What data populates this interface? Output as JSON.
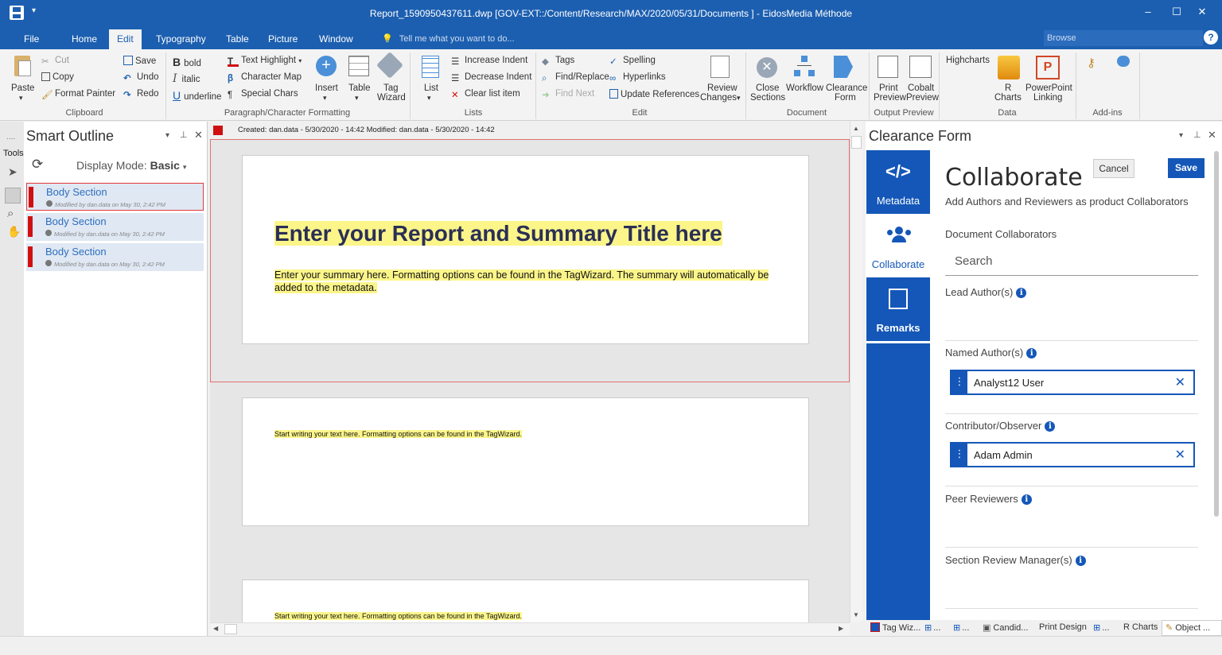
{
  "title_bar": {
    "title": "Report_1590950437611.dwp  [GOV-EXT::/Content/Research/MAX/2020/05/31/Documents ] - EidosMedia Méthode",
    "minimize": "–",
    "maximize": "☐",
    "close": "✕"
  },
  "menu": {
    "tabs": [
      "File",
      "Home",
      "Edit",
      "Typography",
      "Table",
      "Picture",
      "Window"
    ],
    "active": "Edit",
    "tell_me": "Tell me what you want to do...",
    "browse": "Browse",
    "help": "?"
  },
  "ribbon": {
    "clipboard": {
      "paste": "Paste",
      "cut": "Cut",
      "copy": "Copy",
      "format_painter": "Format Painter",
      "save": "Save",
      "undo": "Undo",
      "redo": "Redo",
      "group": "Clipboard"
    },
    "formatting": {
      "bold": "bold",
      "italic": "italic",
      "underline": "underline",
      "text_highlight": "Text Highlight",
      "character_map": "Character Map",
      "special_chars": "Special Chars",
      "insert": "Insert",
      "table": "Table",
      "tag": "Tag",
      "wizard": "Wizard",
      "group": "Paragraph/Character Formatting"
    },
    "lists": {
      "list": "List",
      "increase_indent": "Increase Indent",
      "decrease_indent": "Decrease Indent",
      "clear_list_item": "Clear list item",
      "group": "Lists"
    },
    "edit": {
      "tags": "Tags",
      "find_replace": "Find/Replace",
      "find_next": "Find Next",
      "spelling": "Spelling",
      "hyperlinks": "Hyperlinks",
      "update_references": "Update References",
      "review": "Review",
      "changes": "Changes",
      "group": "Edit"
    },
    "document": {
      "close": "Close",
      "sections": "Sections",
      "workflow": "Workflow",
      "clearance": "Clearance",
      "form": "Form",
      "group": "Document"
    },
    "output": {
      "print": "Print",
      "print_preview": "Preview",
      "cobalt": "Cobalt",
      "cobalt_preview": "Preview",
      "group": "Output Preview"
    },
    "data": {
      "highcharts": "Highcharts",
      "r": "R",
      "charts": "Charts",
      "powerpoint": "PowerPoint",
      "linking": "Linking",
      "group": "Data"
    },
    "addins": {
      "group": "Add-ins"
    }
  },
  "tools_label": "Tools",
  "smart_outline": {
    "title": "Smart Outline",
    "display_mode_label": "Display Mode:",
    "display_mode_value": "Basic",
    "sections": [
      {
        "label": "Body Section",
        "meta": "Modified by dan.data on May 30, 2:42 PM"
      },
      {
        "label": "Body Section",
        "meta": "Modified by dan.data on May 30, 2:42 PM"
      },
      {
        "label": "Body Section",
        "meta": "Modified by dan.data on May 30, 2:42 PM"
      }
    ]
  },
  "document": {
    "info": "Created: dan.data - 5/30/2020 - 14:42   Modified: dan.data - 5/30/2020 - 14:42",
    "title": "Enter your Report and Summary Title here",
    "summary": "Enter your summary here. Formatting options can be found in the TagWizard. The summary will automatically be added to the metadata.",
    "body_placeholder": "Start writing your text here. Formatting options can be found in the TagWizard."
  },
  "clearance_form": {
    "title": "Clearance Form",
    "nav": [
      "Metadata",
      "Collaborate",
      "Remarks"
    ],
    "heading": "Collaborate",
    "subheading": "Add Authors and Reviewers as product Collaborators",
    "cancel": "Cancel",
    "save": "Save",
    "doc_collab": "Document Collaborators",
    "search_placeholder": "Search",
    "lead_authors": "Lead Author(s)",
    "named_authors": "Named Author(s)",
    "named_author_value": "Analyst12 User",
    "contributor": "Contributor/Observer",
    "contributor_value": "Adam Admin",
    "peer_reviewers": "Peer Reviewers",
    "section_review": "Section Review Manager(s)"
  },
  "bottom_tabs": [
    "Tag Wiz...",
    "...",
    "...",
    "Candid...",
    "Print Design",
    "...",
    "R Charts",
    "Object ..."
  ],
  "colors": {
    "brand": "#1c5fb0",
    "nav": "#1457b8",
    "flag": "#d01010",
    "highlight": "#fbf58a"
  }
}
